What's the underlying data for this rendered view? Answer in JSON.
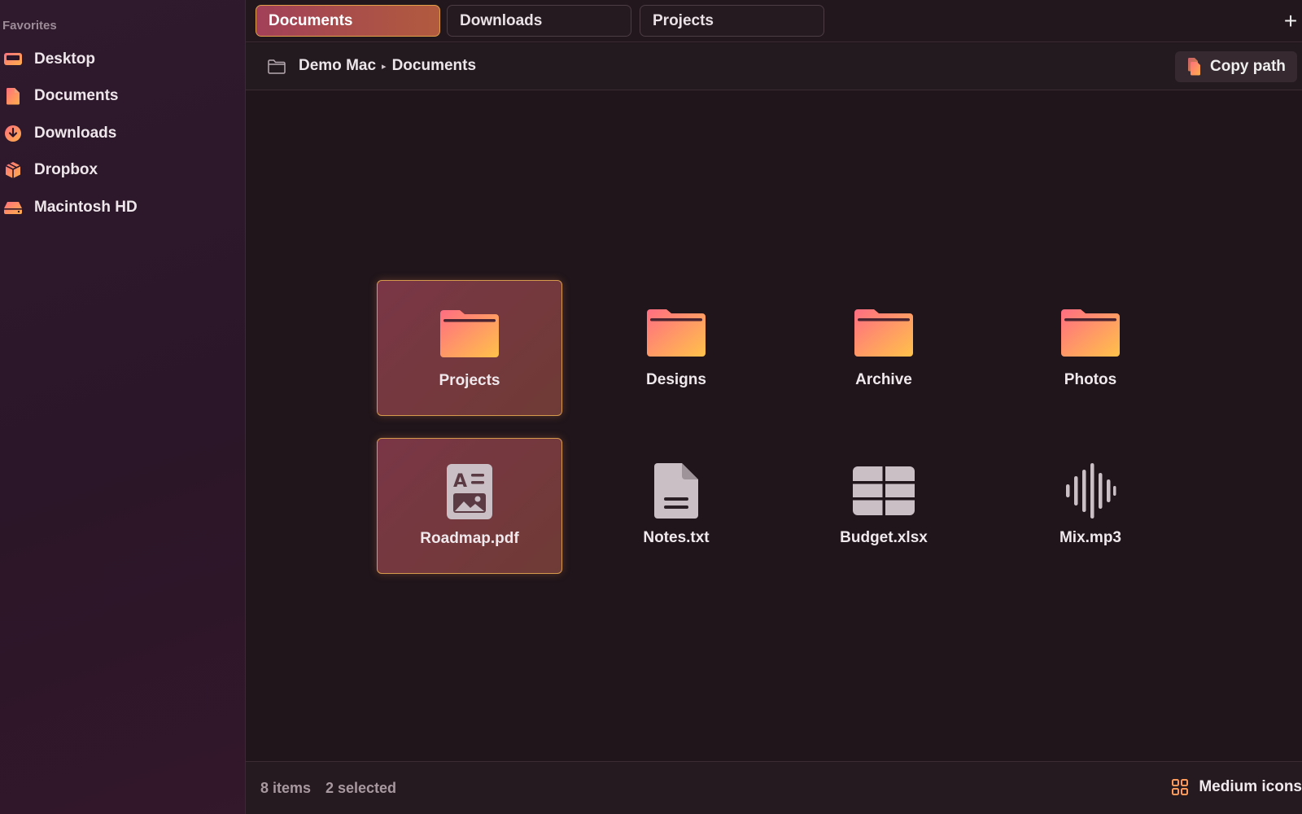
{
  "sidebar": {
    "heading": "Favorites",
    "items": [
      {
        "label": "Desktop",
        "icon": "desktop-icon"
      },
      {
        "label": "Documents",
        "icon": "document-icon"
      },
      {
        "label": "Downloads",
        "icon": "download-icon"
      },
      {
        "label": "Dropbox",
        "icon": "dropbox-icon"
      },
      {
        "label": "Macintosh HD",
        "icon": "drive-icon"
      }
    ]
  },
  "tabs": [
    {
      "label": "Documents",
      "active": true
    },
    {
      "label": "Downloads",
      "active": false
    },
    {
      "label": "Projects",
      "active": false
    }
  ],
  "tab_add": "+",
  "path": {
    "breadcrumb": [
      "Demo Mac",
      "Documents"
    ],
    "separator": "▸",
    "copy_label": "Copy path"
  },
  "items": [
    {
      "name": "Projects",
      "kind": "folder",
      "selected": true
    },
    {
      "name": "Designs",
      "kind": "folder",
      "selected": false
    },
    {
      "name": "Archive",
      "kind": "folder",
      "selected": false
    },
    {
      "name": "Photos",
      "kind": "folder",
      "selected": false
    },
    {
      "name": "Roadmap.pdf",
      "kind": "pdf",
      "selected": true
    },
    {
      "name": "Notes.txt",
      "kind": "text",
      "selected": false
    },
    {
      "name": "Budget.xlsx",
      "kind": "spreadsheet",
      "selected": false
    },
    {
      "name": "Mix.mp3",
      "kind": "audio",
      "selected": false
    }
  ],
  "status": {
    "count": "8 items",
    "selected": "2 selected",
    "view_mode": "Medium icons"
  },
  "colors": {
    "accent_start": "#ff6f7d",
    "accent_end": "#ffc24a",
    "selection_border": "#d59a4c"
  }
}
